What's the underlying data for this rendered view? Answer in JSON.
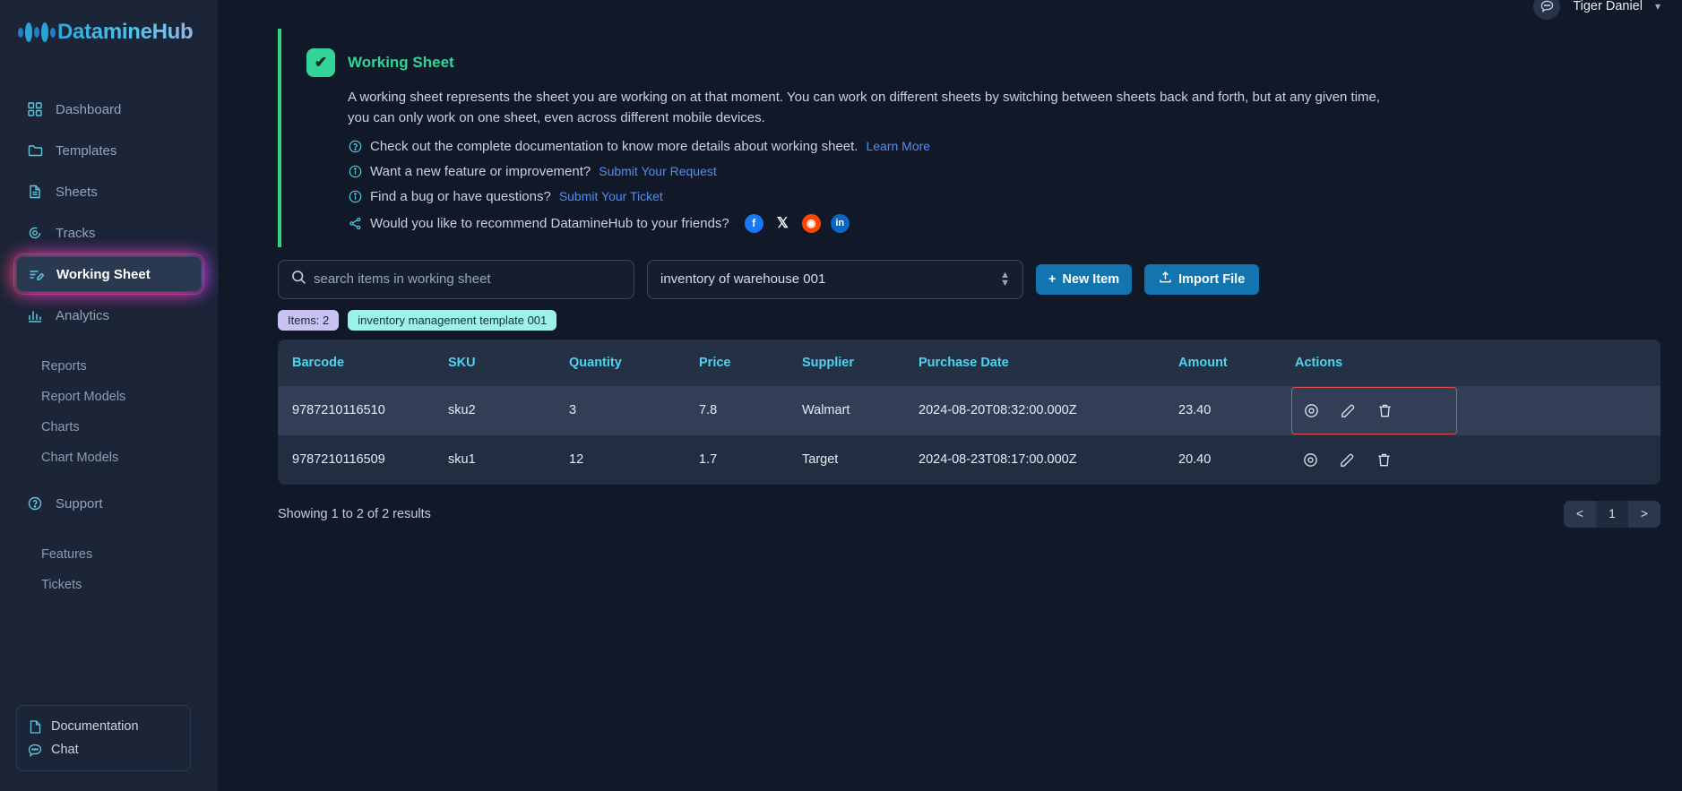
{
  "brand": {
    "name": "DatamineHub"
  },
  "topbar": {
    "chat_icon": "chat-bubble-icon",
    "user_name": "Tiger Daniel",
    "caret": "⌄"
  },
  "sidebar": {
    "items": [
      {
        "label": "Dashboard",
        "icon": "grid-icon"
      },
      {
        "label": "Templates",
        "icon": "folder-icon"
      },
      {
        "label": "Sheets",
        "icon": "document-icon"
      },
      {
        "label": "Tracks",
        "icon": "target-icon"
      },
      {
        "label": "Working Sheet",
        "icon": "edit-list-icon",
        "active": true
      },
      {
        "label": "Analytics",
        "icon": "bar-chart-icon"
      }
    ],
    "analytics_sub": [
      "Reports",
      "Report Models",
      "Charts",
      "Chart Models"
    ],
    "support": {
      "label": "Support",
      "icon": "question-circle-icon"
    },
    "support_sub": [
      "Features",
      "Tickets"
    ],
    "bottom": [
      {
        "label": "Documentation",
        "icon": "file-icon"
      },
      {
        "label": "Chat",
        "icon": "chat-icon"
      }
    ]
  },
  "banner": {
    "title": "Working Sheet",
    "check_icon": "check-icon",
    "description": "A working sheet represents the sheet you are working on at that moment. You can work on different sheets by switching between sheets back and forth, but at any given time, you can only work on one sheet, even across different mobile devices.",
    "doc_line": "Check out the complete documentation to know more details about working sheet.",
    "doc_link": "Learn More",
    "feature_line": "Want a new feature or improvement?",
    "feature_link": "Submit Your Request",
    "bug_line": "Find a bug or have questions?",
    "bug_link": "Submit Your Ticket",
    "share_line": "Would you like to recommend DatamineHub to your friends?",
    "socials": [
      {
        "name": "facebook-icon",
        "glyph": "f"
      },
      {
        "name": "x-twitter-icon",
        "glyph": "𝕏"
      },
      {
        "name": "reddit-icon",
        "glyph": "◉"
      },
      {
        "name": "linkedin-icon",
        "glyph": "in"
      }
    ]
  },
  "toolbar": {
    "search_placeholder": "search items in working sheet",
    "search_value": "",
    "search_icon": "search-icon",
    "select_value": "inventory of warehouse 001",
    "new_item_label": "New Item",
    "import_label": "Import File",
    "import_icon": "upload-icon"
  },
  "chips": {
    "items_count": "Items: 2",
    "template": "inventory management template 001"
  },
  "table": {
    "columns": [
      "Barcode",
      "SKU",
      "Quantity",
      "Price",
      "Supplier",
      "Purchase Date",
      "Amount",
      "Actions"
    ],
    "rows": [
      {
        "barcode": "9787210116510",
        "sku": "sku2",
        "quantity": "3",
        "price": "7.8",
        "supplier": "Walmart",
        "purchase_date": "2024-08-20T08:32:00.000Z",
        "amount": "23.40",
        "highlight_actions": true
      },
      {
        "barcode": "9787210116509",
        "sku": "sku1",
        "quantity": "12",
        "price": "1.7",
        "supplier": "Target",
        "purchase_date": "2024-08-23T08:17:00.000Z",
        "amount": "20.40",
        "highlight_actions": false
      }
    ],
    "row_actions": [
      "view-icon",
      "edit-icon",
      "delete-icon"
    ]
  },
  "footer": {
    "showing": "Showing 1 to 2 of 2 results",
    "prev": "<",
    "page": "1",
    "next": ">"
  },
  "colors": {
    "accent_green": "#34d399",
    "accent_cyan": "#4dd4f0",
    "link_blue": "#4f8ef7",
    "button_blue": "#1275b0",
    "highlight_red": "#e24b4b"
  }
}
